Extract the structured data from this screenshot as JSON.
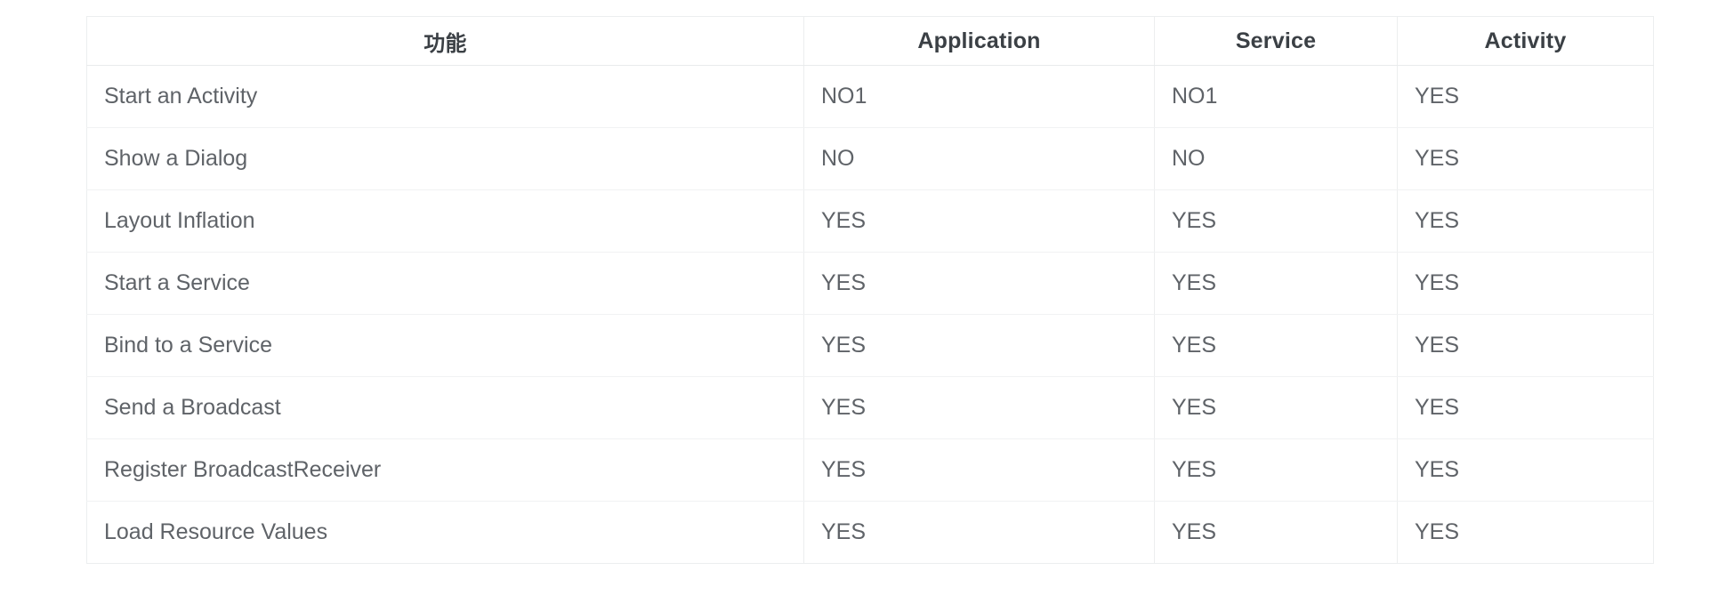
{
  "table": {
    "columns": [
      {
        "key": "feature",
        "label": "功能"
      },
      {
        "key": "application",
        "label": "Application"
      },
      {
        "key": "service",
        "label": "Service"
      },
      {
        "key": "activity",
        "label": "Activity"
      }
    ],
    "rows": [
      {
        "feature": "Start an Activity",
        "application": "NO1",
        "service": "NO1",
        "activity": "YES"
      },
      {
        "feature": "Show a Dialog",
        "application": "NO",
        "service": "NO",
        "activity": "YES"
      },
      {
        "feature": "Layout Inflation",
        "application": "YES",
        "service": "YES",
        "activity": "YES"
      },
      {
        "feature": "Start a Service",
        "application": "YES",
        "service": "YES",
        "activity": "YES"
      },
      {
        "feature": "Bind to a Service",
        "application": "YES",
        "service": "YES",
        "activity": "YES"
      },
      {
        "feature": "Send a Broadcast",
        "application": "YES",
        "service": "YES",
        "activity": "YES"
      },
      {
        "feature": "Register BroadcastReceiver",
        "application": "YES",
        "service": "YES",
        "activity": "YES"
      },
      {
        "feature": "Load Resource Values",
        "application": "YES",
        "service": "YES",
        "activity": "YES"
      }
    ]
  },
  "colors": {
    "header_text": "#3b4045",
    "body_text": "#5f6368",
    "border": "#eceeef",
    "row_divider": "#f1f2f3",
    "background": "#ffffff"
  }
}
